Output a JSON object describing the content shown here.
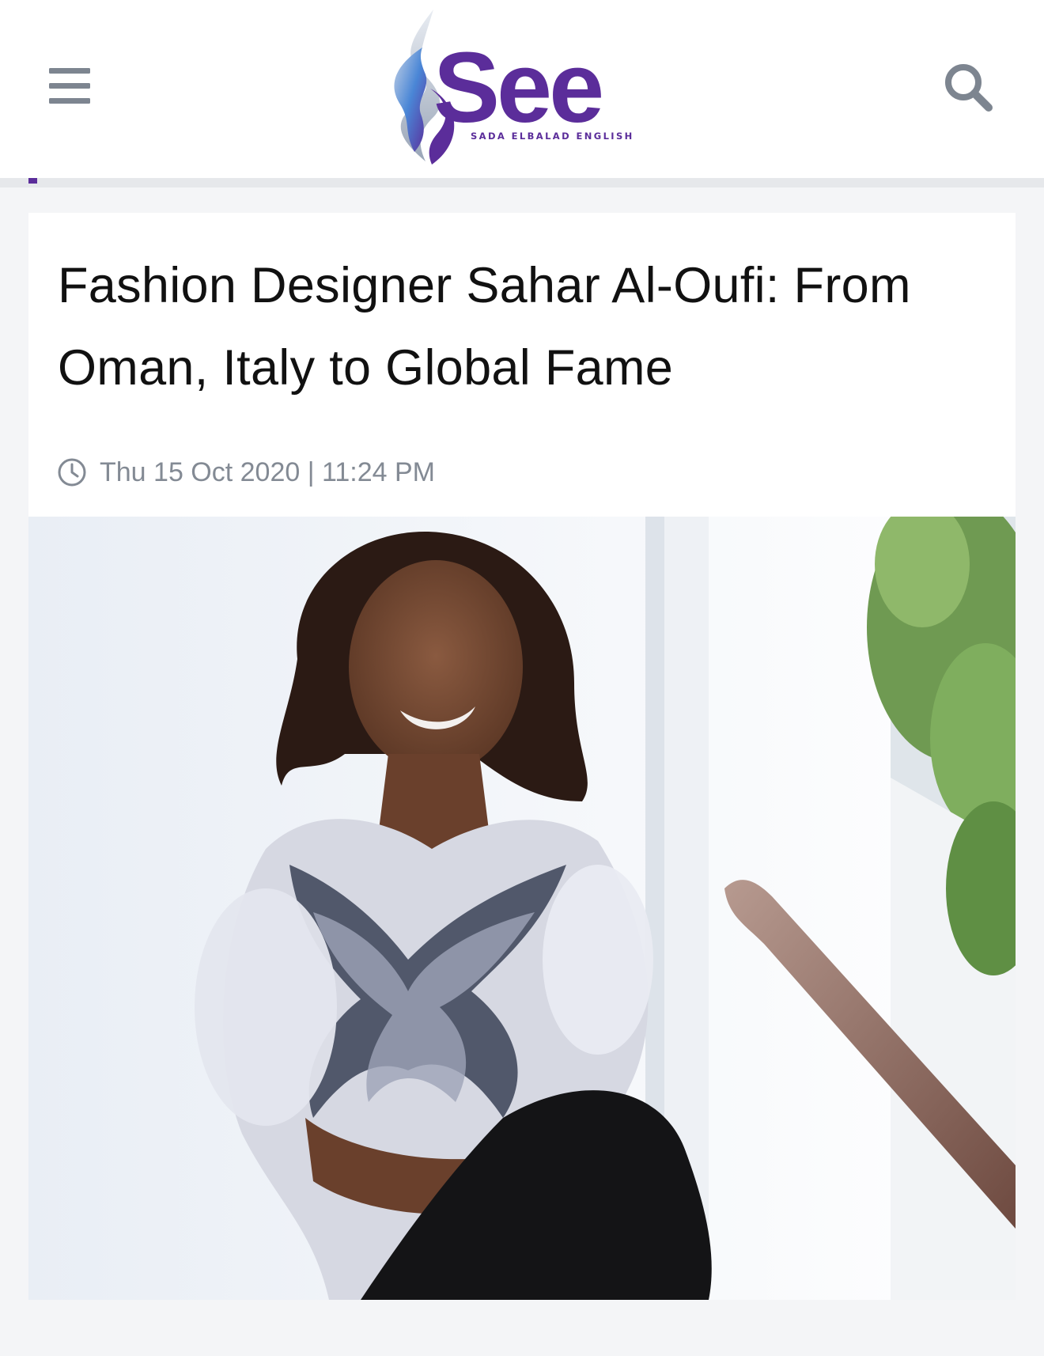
{
  "header": {
    "logo": {
      "wordmark": "See",
      "tagline": "SADA ELBALAD ENGLISH"
    },
    "menu_icon": "hamburger-menu-icon",
    "search_icon": "search-icon"
  },
  "article": {
    "title": "Fashion Designer Sahar Al-Oufi: From Oman, Italy to Global Fame",
    "date": "Thu 15 Oct 2020 | 11:24 PM",
    "date_icon": "clock-icon"
  },
  "colors": {
    "brand_purple": "#5b2d9a",
    "icon_gray": "#7d8590",
    "meta_gray": "#838a94",
    "page_bg": "#f4f5f7"
  }
}
